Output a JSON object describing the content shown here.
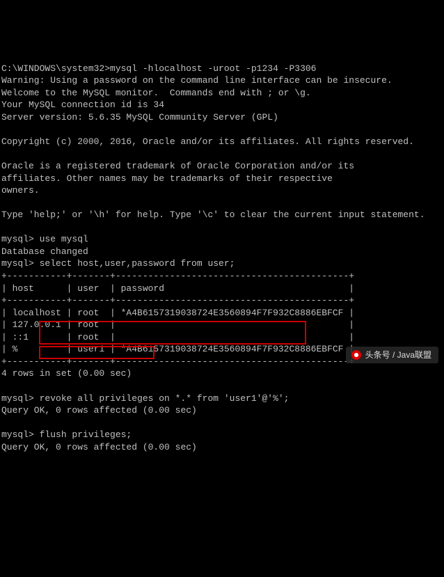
{
  "prompt_path": "C:\\WINDOWS\\system32>",
  "login_cmd": "mysql -hlocalhost -uroot -p1234 -P3306",
  "warning": "Warning: Using a password on the command line interface can be insecure.",
  "welcome1": "Welcome to the MySQL monitor.  Commands end with ; or \\g.",
  "conn_id": "Your MySQL connection id is 34",
  "version": "Server version: 5.6.35 MySQL Community Server (GPL)",
  "copyright": "Copyright (c) 2000, 2016, Oracle and/or its affiliates. All rights reserved.",
  "trademark1": "Oracle is a registered trademark of Oracle Corporation and/or its",
  "trademark2": "affiliates. Other names may be trademarks of their respective",
  "trademark3": "owners.",
  "help_line": "Type 'help;' or '\\h' for help. Type '\\c' to clear the current input statement.",
  "mysql_prompt": "mysql>",
  "cmd_use": " use mysql",
  "db_changed": "Database changed",
  "cmd_select": " select host,user,password from user;",
  "tbl_border_top": "+-----------+-------+-------------------------------------------+",
  "tbl_header": "| host      | user  | password                                  |",
  "tbl_border_mid": "+-----------+-------+-------------------------------------------+",
  "tbl_row1": "| localhost | root  | *A4B6157319038724E3560894F7F932C8886EBFCF |",
  "tbl_row2": "| 127.0.0.1 | root  |                                           |",
  "tbl_row3": "| ::1       | root  |                                           |",
  "tbl_row4": "| %         | user1 | *A4B6157319038724E3560894F7F932C8886EBFCF |",
  "tbl_border_bot": "+-----------+-------+-------------------------------------------+",
  "rows_in_set": "4 rows in set (0.00 sec)",
  "cmd_revoke": " revoke all privileges on *.* from 'user1'@'%';",
  "query_ok1": "Query OK, 0 rows affected (0.00 sec)",
  "cmd_flush": " flush privileges;",
  "query_ok2": "Query OK, 0 rows affected (0.00 sec)",
  "watermark_text": "头条号 / Java联盟"
}
